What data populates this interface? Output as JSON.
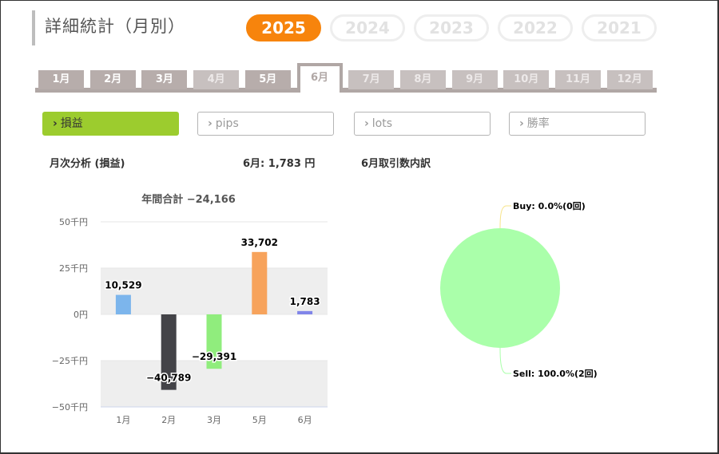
{
  "page_title": "詳細統計（月別）",
  "years": [
    {
      "label": "2025",
      "active": true
    },
    {
      "label": "2024",
      "active": false
    },
    {
      "label": "2023",
      "active": false
    },
    {
      "label": "2022",
      "active": false
    },
    {
      "label": "2021",
      "active": false
    }
  ],
  "months": [
    {
      "label": "1月",
      "state": "enabled"
    },
    {
      "label": "2月",
      "state": "enabled"
    },
    {
      "label": "3月",
      "state": "enabled"
    },
    {
      "label": "4月",
      "state": "disabled"
    },
    {
      "label": "5月",
      "state": "enabled"
    },
    {
      "label": "6月",
      "state": "active"
    },
    {
      "label": "7月",
      "state": "disabled"
    },
    {
      "label": "8月",
      "state": "disabled"
    },
    {
      "label": "9月",
      "state": "disabled"
    },
    {
      "label": "10月",
      "state": "disabled"
    },
    {
      "label": "11月",
      "state": "disabled"
    },
    {
      "label": "12月",
      "state": "disabled"
    }
  ],
  "metrics": [
    {
      "label": "損益",
      "active": true
    },
    {
      "label": "pips",
      "active": false
    },
    {
      "label": "lots",
      "active": false
    },
    {
      "label": "勝率",
      "active": false
    }
  ],
  "analysis": {
    "heading": "月次分析 (損益)",
    "current_month_summary": "6月:  1,783 円",
    "breakdown_heading": "6月取引数内訳"
  },
  "chart_data": [
    {
      "type": "bar",
      "title": "年間合計 −24,166",
      "categories": [
        "1月",
        "2月",
        "3月",
        "5月",
        "6月"
      ],
      "values": [
        10529,
        -40789,
        -29391,
        33702,
        1783
      ],
      "value_labels": [
        "10,529",
        "−40,789",
        "−29,391",
        "33,702",
        "1,783"
      ],
      "colors": [
        "#7cb5ec",
        "#434348",
        "#90ed7d",
        "#f7a35c",
        "#8085e9"
      ],
      "ylim": [
        -50000,
        50000
      ],
      "yticks": [
        {
          "value": 50000,
          "label": "50千円"
        },
        {
          "value": 25000,
          "label": "25千円"
        },
        {
          "value": 0,
          "label": "0円"
        },
        {
          "value": -25000,
          "label": "−25千円"
        },
        {
          "value": -50000,
          "label": "−50千円"
        }
      ],
      "grid": true,
      "alternate_bands": true
    },
    {
      "type": "pie",
      "slices": [
        {
          "name": "Buy",
          "label": "Buy: 0.0%(0回)",
          "value": 0
        },
        {
          "name": "Sell",
          "label": "Sell: 100.0%(2回)",
          "value": 100
        }
      ],
      "colors": [
        "#f7e48a",
        "#aaffaa"
      ]
    }
  ]
}
